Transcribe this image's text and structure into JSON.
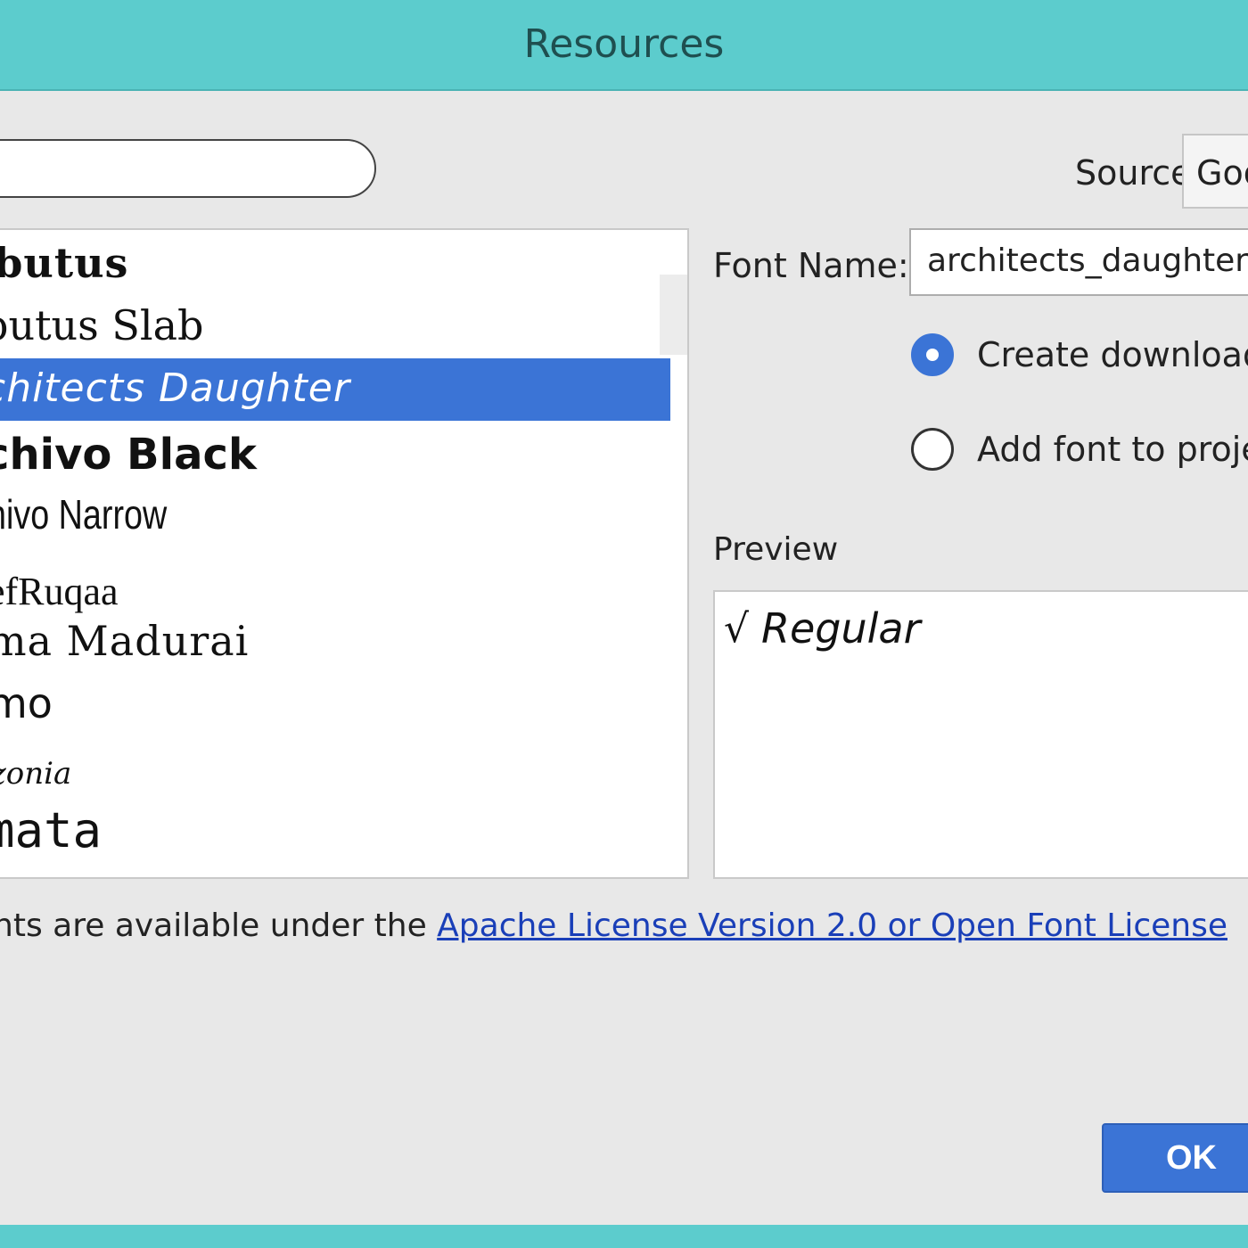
{
  "window": {
    "title": "Resources"
  },
  "search": {
    "value": ""
  },
  "source": {
    "label": "Source",
    "selected": "Goo"
  },
  "font_list": {
    "items": [
      {
        "label": "rbutus"
      },
      {
        "label": "butus Slab"
      },
      {
        "label": "chitects Daughter"
      },
      {
        "label": "chivo Black"
      },
      {
        "label": "hivo Narrow"
      },
      {
        "label": "efRuqaa"
      },
      {
        "label": "ma Madurai"
      },
      {
        "label": "mo"
      },
      {
        "label": "izonia"
      },
      {
        "label": "mata"
      }
    ],
    "selected_index": 2
  },
  "font_name": {
    "label": "Font Name:",
    "value": "architects_daughter"
  },
  "options": {
    "create_downloadable": "Create downloada",
    "add_to_project": "Add font to projec",
    "selected": "create_downloadable"
  },
  "preview": {
    "label": "Preview",
    "check": "√",
    "style": "Regular"
  },
  "license": {
    "prefix": "onts are available under the ",
    "link": "Apache License Version 2.0 or Open Font License"
  },
  "buttons": {
    "ok": "OK"
  },
  "colors": {
    "title_bar": "#5ccccd",
    "selection": "#3b74d6",
    "link": "#1a3fb8"
  }
}
